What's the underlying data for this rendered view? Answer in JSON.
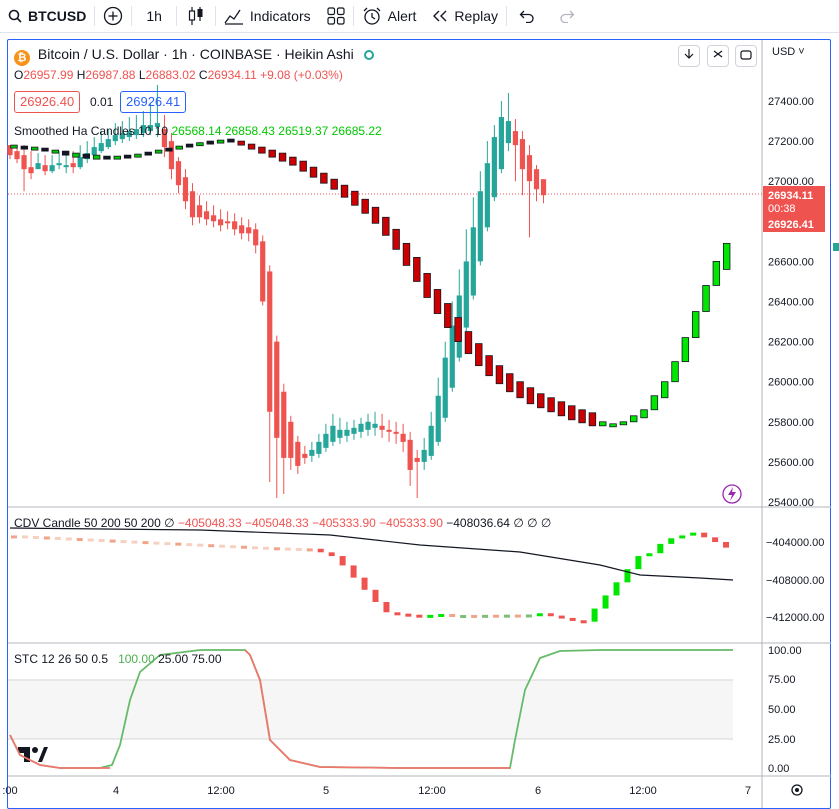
{
  "toolbar": {
    "symbol": "BTCUSD",
    "interval": "1h",
    "indicators": "Indicators",
    "alert": "Alert",
    "replay": "Replay"
  },
  "header": {
    "title": "Bitcoin / U.S. Dollar · 1h · COINBASE · Heikin Ashi",
    "ohlc": {
      "o_label": "O",
      "o": "26957.99",
      "h_label": "H",
      "h": "26987.88",
      "l_label": "L",
      "l": "26883.02",
      "c_label": "C",
      "c": "26934.11",
      "change": "+9.08 (+0.03%)"
    },
    "sell_price": "26926.40",
    "spread": "0.01",
    "buy_price": "26926.41"
  },
  "indicators": {
    "smoothed": {
      "label": "Smoothed Ha Candles 10 10",
      "v1": "26568.14",
      "v2": "26858.43",
      "v3": "26519.37",
      "v4": "26685.22"
    },
    "cdv": {
      "label": "CDV Candle 50 200 50 200",
      "v0": "∅",
      "v1": "−405048.33",
      "v2": "−405048.33",
      "v3": "−405333.90",
      "v4": "−405333.90",
      "v5": "−408036.64",
      "v6": "∅",
      "v7": "∅",
      "v8": "∅"
    },
    "stc": {
      "label": "STC 12 26 50 0.5",
      "v1": "100.00",
      "v2": "25.00",
      "v3": "75.00"
    }
  },
  "price_axis": {
    "currency": "USD",
    "ticks": [
      "27400.00",
      "27200.00",
      "27000.00",
      "26800.00",
      "26600.00",
      "26400.00",
      "26200.00",
      "26000.00",
      "25800.00",
      "25600.00",
      "25400.00"
    ],
    "last_price": "26934.11",
    "countdown": "00:38",
    "bid_price": "26926.41"
  },
  "cdv_axis": {
    "ticks": [
      "−404000.00",
      "−408000.00",
      "−412000.00"
    ]
  },
  "stc_axis": {
    "ticks": [
      "100.00",
      "75.00",
      "50.00",
      "25.00",
      "0.00"
    ]
  },
  "time_axis": {
    "ticks": [
      ":00",
      "4",
      "12:00",
      "5",
      "12:00",
      "6",
      "12:00",
      "7"
    ]
  },
  "colors": {
    "up": "#26a69a",
    "down": "#ef5350",
    "accent": "#2962ff",
    "bright_green": "#00e600",
    "dark_red": "#cc0000",
    "stc_green": "#66bb6a",
    "stc_red": "#f0766d"
  }
}
